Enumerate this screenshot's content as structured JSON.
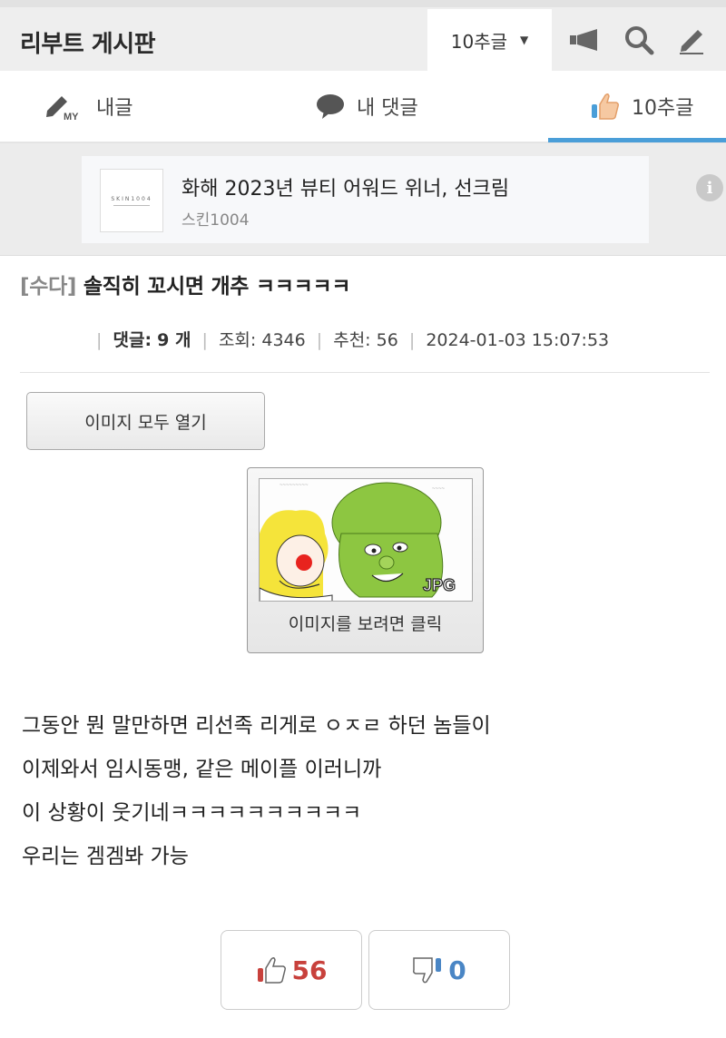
{
  "header": {
    "board_title": "리부트 게시판",
    "sort_label": "10추글"
  },
  "tabs": [
    {
      "label": "내글",
      "icon": "pencil-my-icon"
    },
    {
      "label": "내 댓글",
      "icon": "speech-bubble-icon"
    },
    {
      "label": "10추글",
      "icon": "thumbs-up-icon",
      "active": true
    }
  ],
  "ad": {
    "logo_text": "SKIN1004",
    "title": "화해 2023년 뷰티 어워드 위너, 선크림",
    "advertiser": "스킨1004",
    "info_glyph": "i"
  },
  "post": {
    "category": "[수다]",
    "title": "솔직히 꼬시면 개추 ㅋㅋㅋㅋㅋ",
    "comments_label": "댓글:",
    "comments_value": "9 개",
    "views_label": "조회:",
    "views_value": "4346",
    "recommend_label": "추천:",
    "recommend_value": "56",
    "datetime": "2024-01-03 15:07:53"
  },
  "images": {
    "open_all_label": "이미지 모두 열기",
    "thumb_badge": "JPG",
    "thumb_caption": "이미지를 보려면 클릭"
  },
  "body_lines": [
    "그동안 뭔 말만하면 리선족 리게로 ㅇㅈㄹ 하던 놈들이",
    "이제와서 임시동맹, 같은 메이플 이러니까",
    "이 상황이 웃기네ㅋㅋㅋㅋㅋㅋㅋㅋㅋㅋ",
    "우리는 겜겜봐 가능"
  ],
  "votes": {
    "up": "56",
    "down": "0"
  },
  "colors": {
    "accent_blue": "#4a9ed8",
    "upvote_red": "#c8413c",
    "downvote_blue": "#4a86c5"
  }
}
